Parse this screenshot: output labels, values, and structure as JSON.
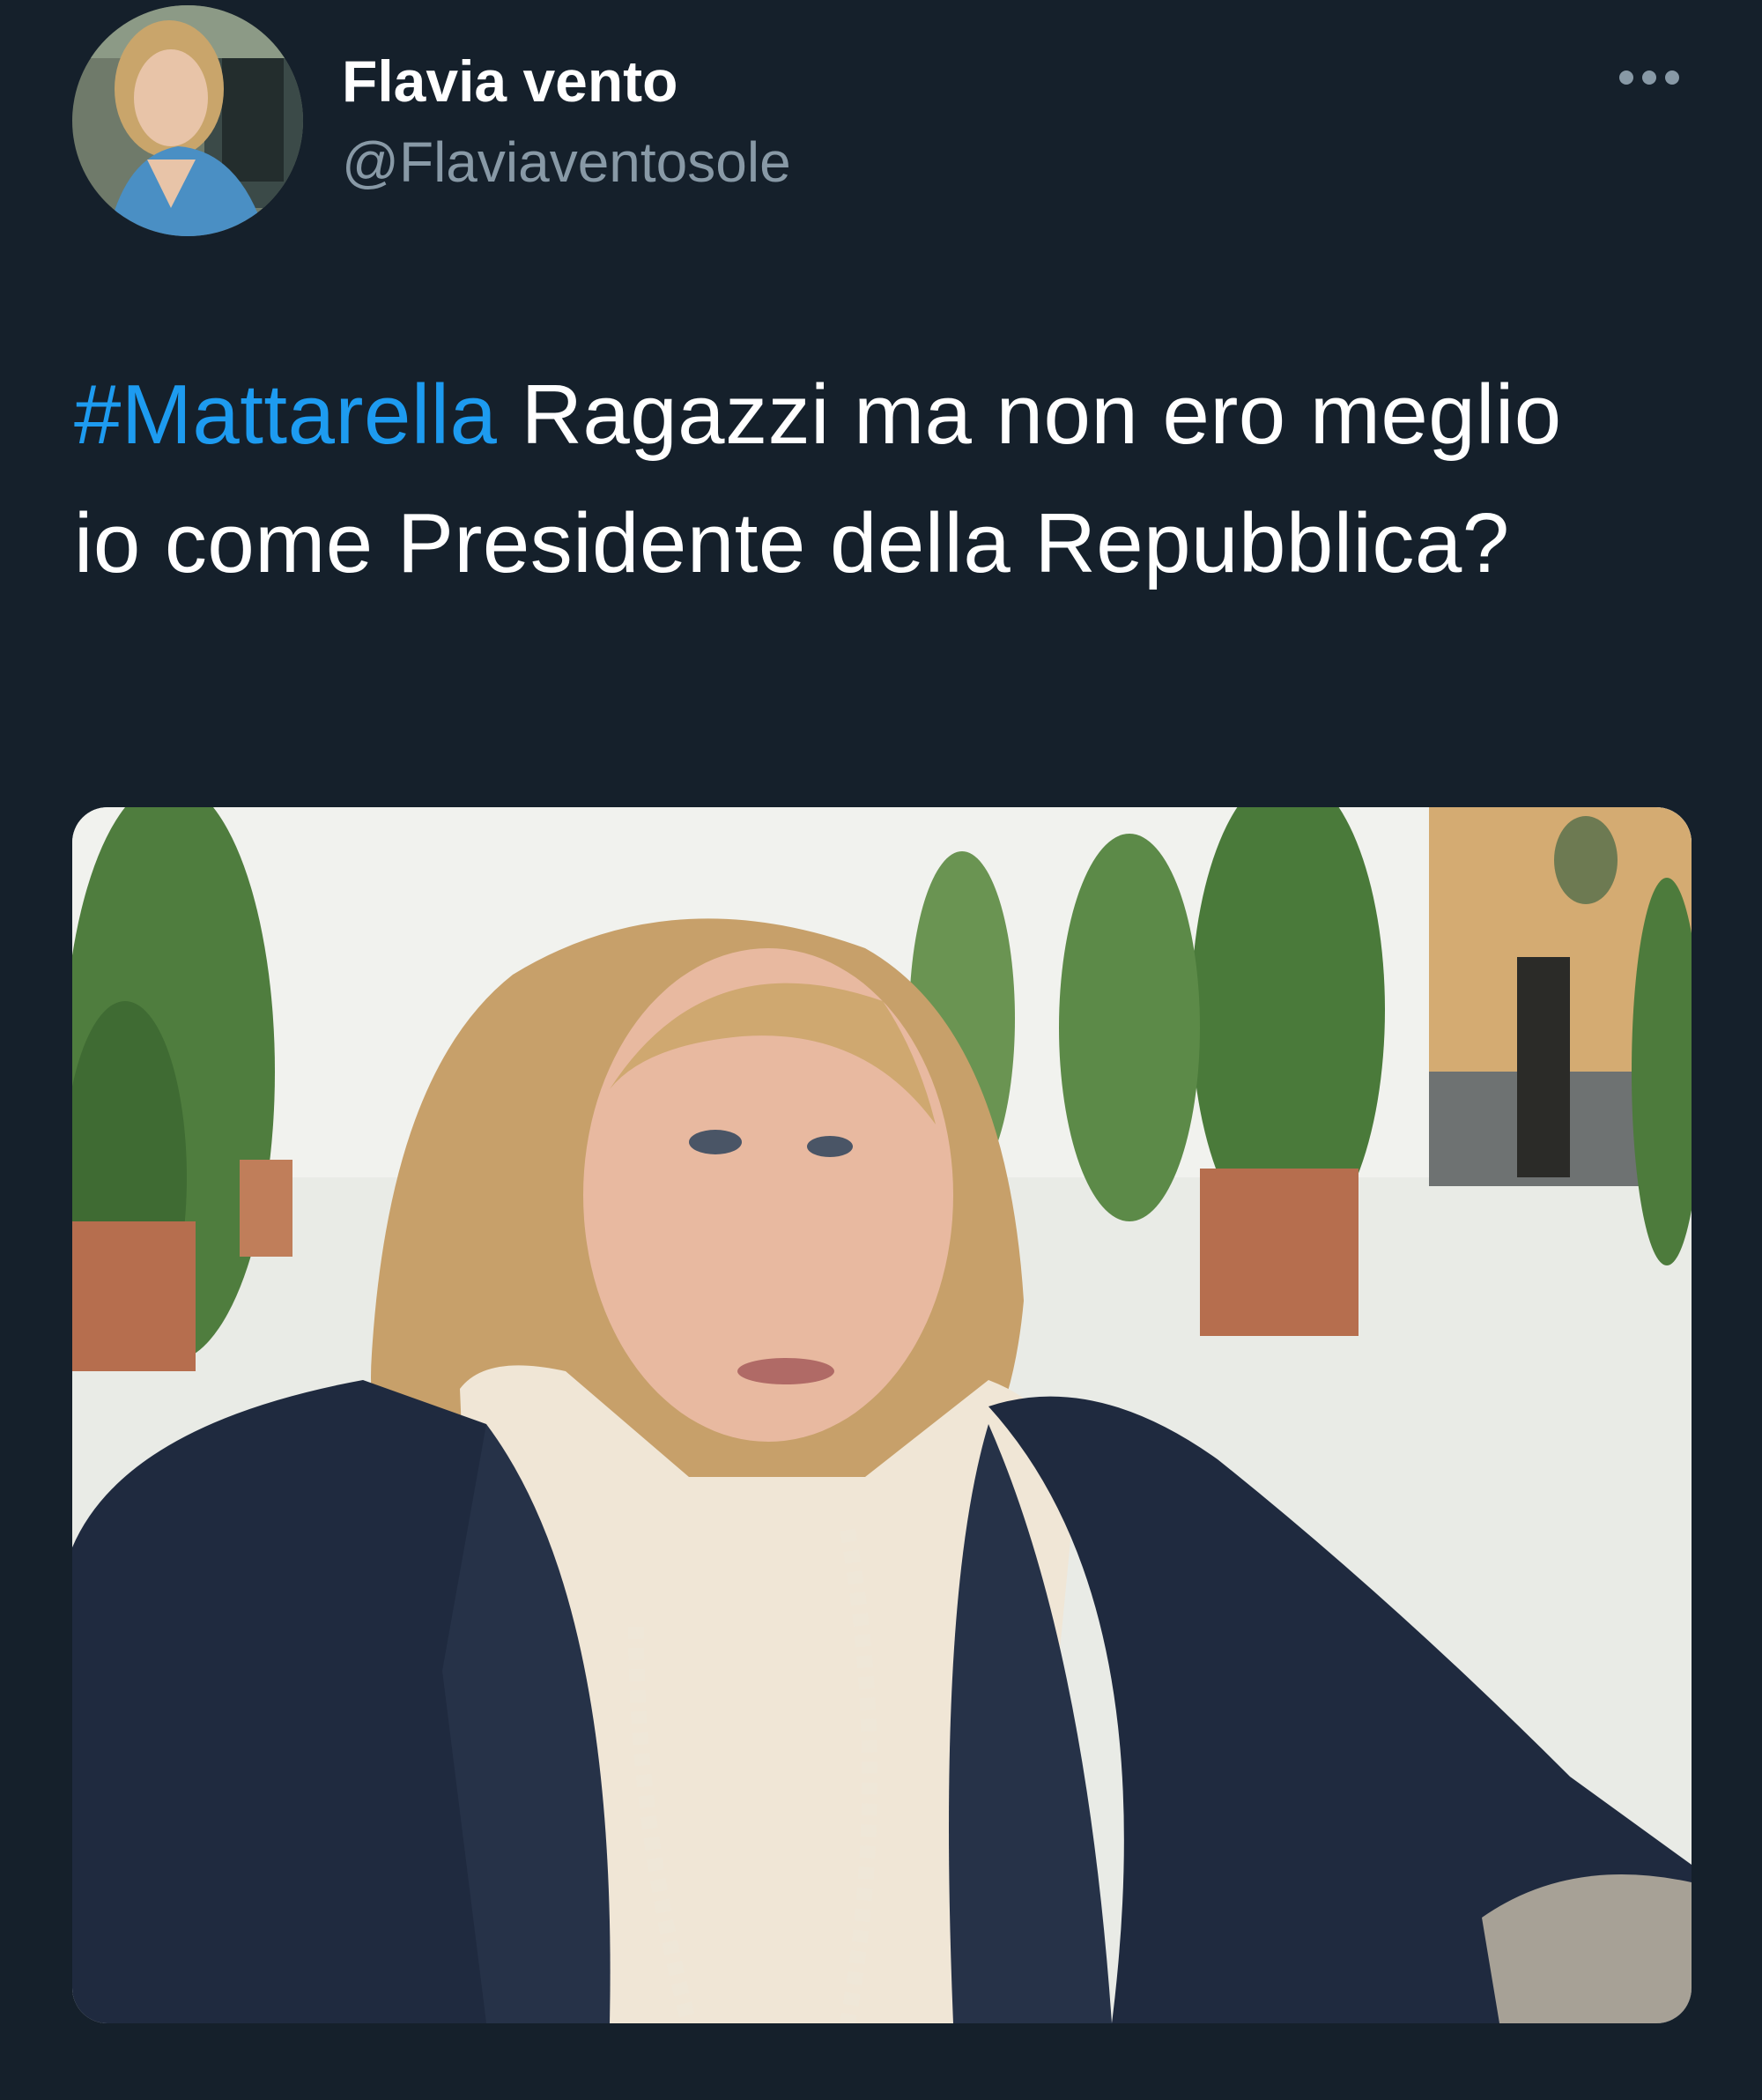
{
  "tweet": {
    "author": {
      "display_name": "Flavia vento",
      "handle": "@Flaviaventosole",
      "avatar_icon": "profile-photo"
    },
    "more_icon": "more-horizontal-icon",
    "text": {
      "hashtag": "#Mattarella",
      "body": " Ragazzi ma non ero meglio io come Presidente della Repubblica?"
    },
    "media": {
      "kind": "photo"
    }
  },
  "colors": {
    "background": "#15202b",
    "text_primary": "#ffffff",
    "text_secondary": "#8899a6",
    "accent": "#1d9bf0"
  }
}
